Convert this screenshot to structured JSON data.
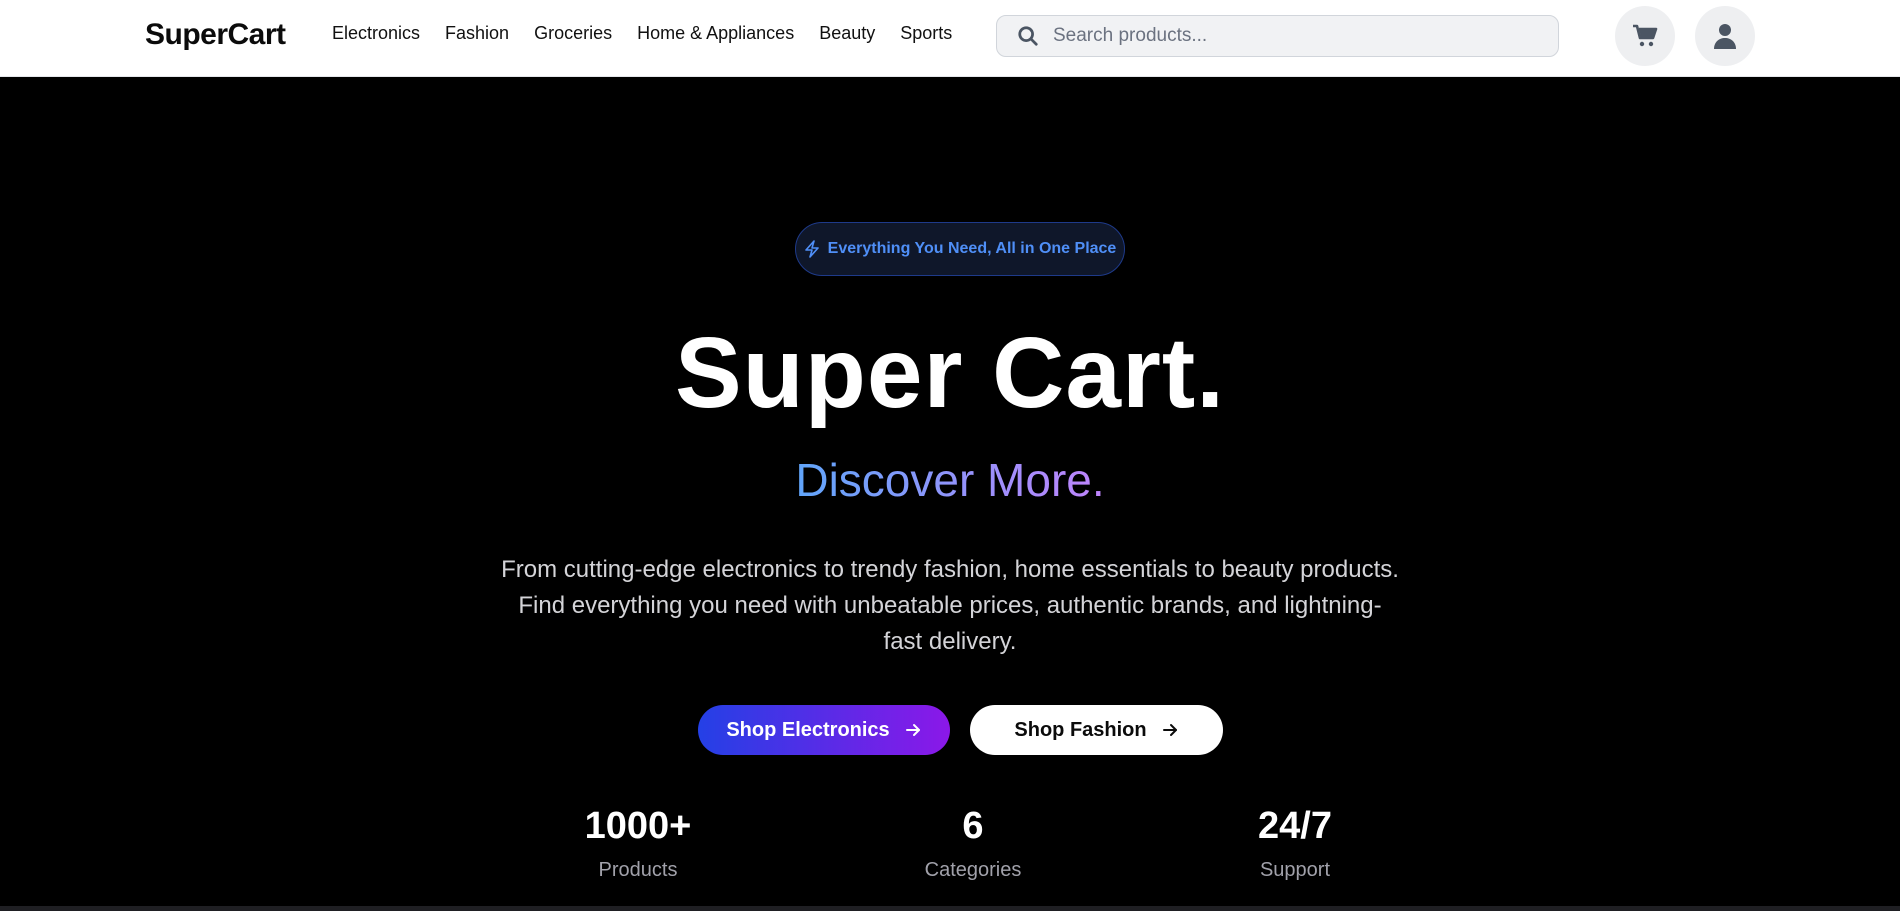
{
  "header": {
    "logo": "SuperCart",
    "nav": [
      "Electronics",
      "Fashion",
      "Groceries",
      "Home & Appliances",
      "Beauty",
      "Sports"
    ],
    "search": {
      "placeholder": "Search products...",
      "value": ""
    },
    "icons": {
      "search": "search-icon",
      "cart": "cart-icon",
      "user": "user-icon"
    }
  },
  "hero": {
    "badge": "Everything You Need, All in One Place",
    "badge_icon": "lightning-icon",
    "title": "Super Cart.",
    "subtitle": "Discover More.",
    "description": "From cutting-edge electronics to trendy fashion, home essentials to beauty products. Find everything you need with unbeatable prices, authentic brands, and lightning-fast delivery.",
    "primary_button": "Shop Electronics",
    "secondary_button": "Shop Fashion",
    "stats": [
      {
        "value": "1000+",
        "label": "Products"
      },
      {
        "value": "6",
        "label": "Categories"
      },
      {
        "value": "24/7",
        "label": "Support"
      }
    ]
  },
  "colors": {
    "accent_blue": "#2440e6",
    "accent_purple": "#8b18e8",
    "badge_text": "#4f8ff7",
    "background": "#000000"
  }
}
